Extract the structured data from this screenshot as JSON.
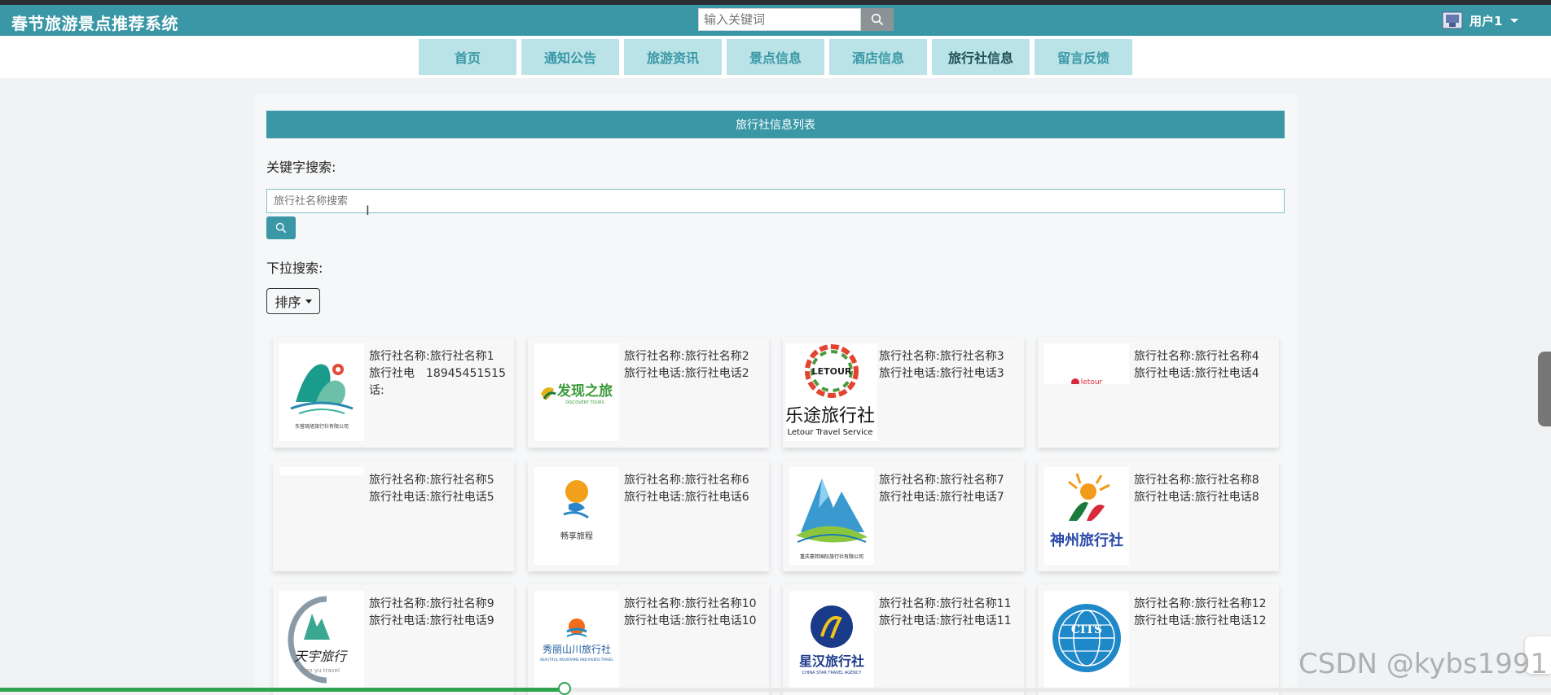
{
  "header": {
    "app_title": "春节旅游景点推荐系统",
    "search_placeholder": "输入关键词",
    "user_name": "用户1"
  },
  "nav": {
    "items": [
      {
        "label": "首页",
        "active": false
      },
      {
        "label": "通知公告",
        "active": false
      },
      {
        "label": "旅游资讯",
        "active": false
      },
      {
        "label": "景点信息",
        "active": false
      },
      {
        "label": "酒店信息",
        "active": false
      },
      {
        "label": "旅行社信息",
        "active": true
      },
      {
        "label": "留言反馈",
        "active": false
      }
    ]
  },
  "main": {
    "panel_title": "旅行社信息列表",
    "keyword_label": "关键字搜索:",
    "search_placeholder": "旅行社名称搜索",
    "dropdown_label": "下拉搜索:",
    "sort_label": "排序"
  },
  "cards": [
    {
      "name_key": "旅行社名称:",
      "name": "旅行社名称1",
      "phone_key": "旅行社电话:",
      "phone": "18945451515",
      "logo_text": "东营琦旭旅行社有限公司"
    },
    {
      "name_key": "旅行社名称:",
      "name": "旅行社名称2",
      "phone_key": "旅行社电话:",
      "phone": "旅行社电话2",
      "logo_text": "发现之旅"
    },
    {
      "name_key": "旅行社名称:",
      "name": "旅行社名称3",
      "phone_key": "旅行社电话:",
      "phone": "旅行社电话3",
      "logo_text": "乐途旅行社"
    },
    {
      "name_key": "旅行社名称:",
      "name": "旅行社名称4",
      "phone_key": "旅行社电话:",
      "phone": "旅行社电话4",
      "logo_text": ""
    },
    {
      "name_key": "旅行社名称:",
      "name": "旅行社名称5",
      "phone_key": "旅行社电话:",
      "phone": "旅行社电话5",
      "logo_text": ""
    },
    {
      "name_key": "旅行社名称:",
      "name": "旅行社名称6",
      "phone_key": "旅行社电话:",
      "phone": "旅行社电话6",
      "logo_text": ""
    },
    {
      "name_key": "旅行社名称:",
      "name": "旅行社名称7",
      "phone_key": "旅行社电话:",
      "phone": "旅行社电话7",
      "logo_text": "重庆豪邦国际旅行社有限公司"
    },
    {
      "name_key": "旅行社名称:",
      "name": "旅行社名称8",
      "phone_key": "旅行社电话:",
      "phone": "旅行社电话8",
      "logo_text": "神州旅行社"
    },
    {
      "name_key": "旅行社名称:",
      "name": "旅行社名称9",
      "phone_key": "旅行社电话:",
      "phone": "旅行社电话9",
      "logo_text": "天宇旅行"
    },
    {
      "name_key": "旅行社名称:",
      "name": "旅行社名称10",
      "phone_key": "旅行社电话:",
      "phone": "旅行社电话10",
      "logo_text": "秀丽山川旅行社"
    },
    {
      "name_key": "旅行社名称:",
      "name": "旅行社名称11",
      "phone_key": "旅行社电话:",
      "phone": "旅行社电话11",
      "logo_text": "星汉旅行社"
    },
    {
      "name_key": "旅行社名称:",
      "name": "旅行社名称12",
      "phone_key": "旅行社电话:",
      "phone": "旅行社电话12",
      "logo_text": "CITS"
    }
  ],
  "watermark": "CSDN @kybs1991",
  "video_progress": 0.364,
  "colors": {
    "primary": "#3a97a6",
    "nav_bg": "#b9e3e6",
    "progress": "#2ea44f"
  }
}
